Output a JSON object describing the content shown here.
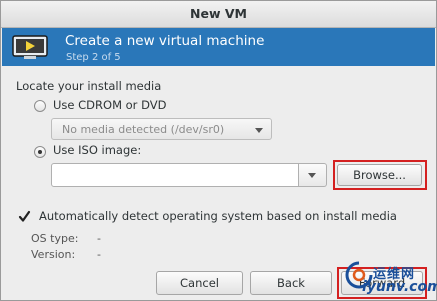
{
  "window": {
    "title": "New VM"
  },
  "banner": {
    "heading": "Create a new virtual machine",
    "step": "Step 2 of 5"
  },
  "media": {
    "section_label": "Locate your install media",
    "cdrom_label": "Use CDROM or DVD",
    "cdrom_selected": false,
    "cdrom_combo_value": "No media detected (/dev/sr0)",
    "iso_label": "Use ISO image:",
    "iso_selected": true,
    "iso_path_value": "",
    "browse_label": "Browse..."
  },
  "detect": {
    "checkbox_label": "Automatically detect operating system based on install media",
    "checked": true,
    "os_type_label": "OS type:",
    "os_type_value": "-",
    "version_label": "Version:",
    "version_value": "-"
  },
  "buttons": {
    "cancel": "Cancel",
    "back": "Back",
    "forward": "Forward"
  },
  "watermark": {
    "cn": "运维网",
    "en": "iyunv.com"
  },
  "colors": {
    "banner": "#2a77b9",
    "highlight": "#d42020",
    "watermark": "#1a4f9a"
  }
}
